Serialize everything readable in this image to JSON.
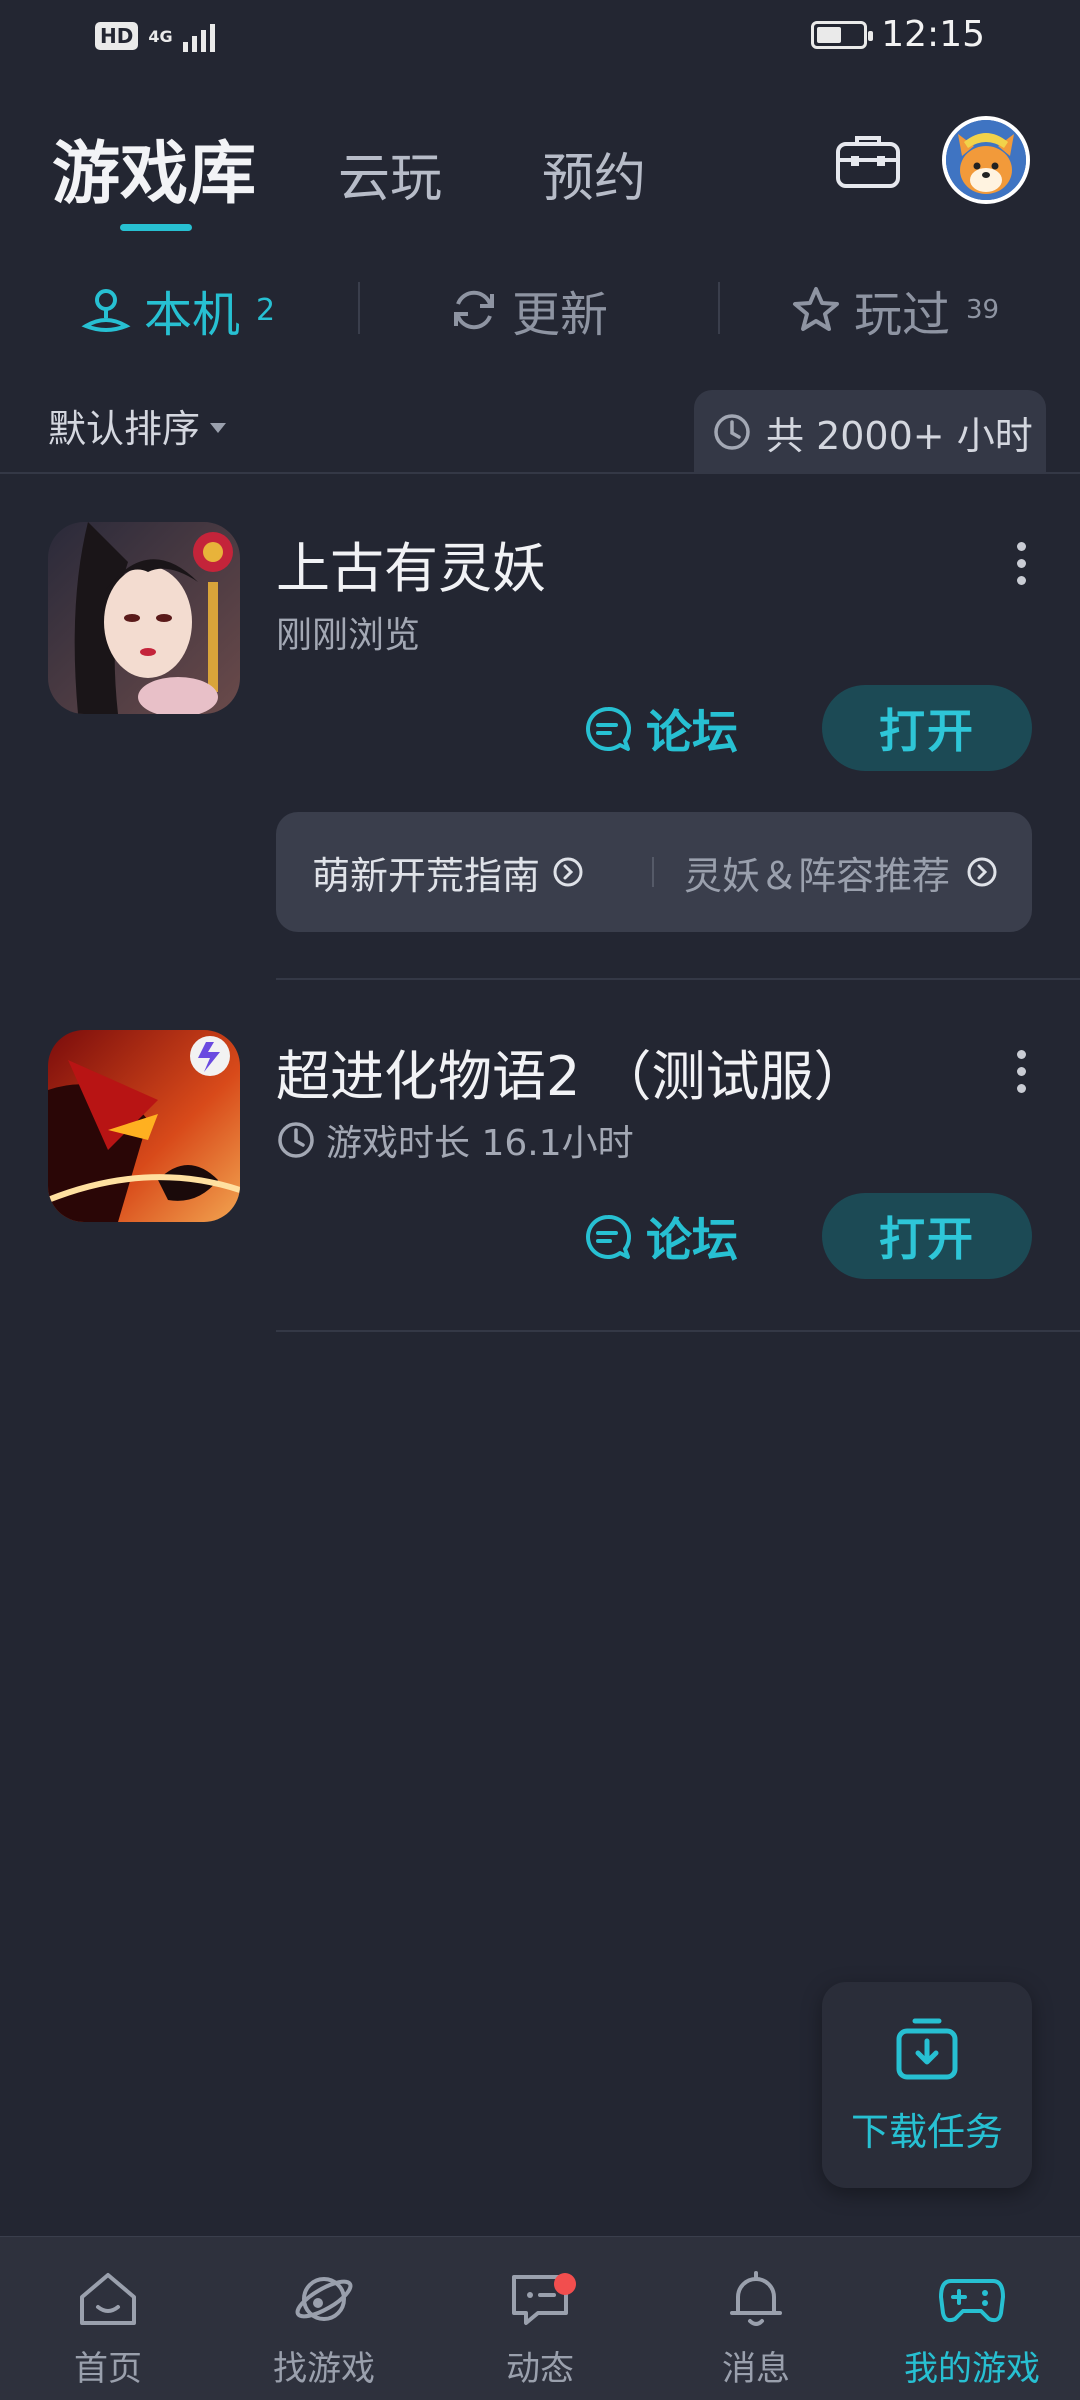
{
  "status_bar": {
    "hd": "HD",
    "network": "4G",
    "time": "12:15"
  },
  "top_tabs": {
    "active": "游戏库",
    "cloud": "云玩",
    "reserve": "预约"
  },
  "icons": {
    "toolbox": "toolbox-icon",
    "avatar": "dog-avatar"
  },
  "sub_tabs": [
    {
      "label": "本机",
      "count": "2",
      "icon": "device-icon",
      "active": true
    },
    {
      "label": "更新",
      "count": "",
      "icon": "refresh-icon",
      "active": false
    },
    {
      "label": "玩过",
      "count": "39",
      "icon": "star-icon",
      "active": false
    }
  ],
  "sort": {
    "label": "默认排序"
  },
  "total_time": {
    "label": "共 2000+ 小时"
  },
  "games": [
    {
      "title": "上古有灵妖",
      "subtitle": "刚刚浏览",
      "forum_label": "论坛",
      "open_label": "打开",
      "guides": [
        "萌新开荒指南",
        "灵妖＆阵容推荐"
      ]
    },
    {
      "title": "超进化物语2 （测试服）",
      "subtitle": "游戏时长 16.1小时",
      "forum_label": "论坛",
      "open_label": "打开"
    }
  ],
  "download_task": {
    "label": "下载任务"
  },
  "bottom_nav": [
    {
      "label": "首页",
      "icon": "home-icon"
    },
    {
      "label": "找游戏",
      "icon": "planet-icon"
    },
    {
      "label": "动态",
      "icon": "chat-icon",
      "badge": true
    },
    {
      "label": "消息",
      "icon": "bell-icon"
    },
    {
      "label": "我的游戏",
      "icon": "gamepad-icon",
      "active": true
    }
  ],
  "colors": {
    "accent": "#27c0d2",
    "background": "#232632",
    "button_bg": "#1c4a55",
    "badge": "#f24e4e"
  }
}
